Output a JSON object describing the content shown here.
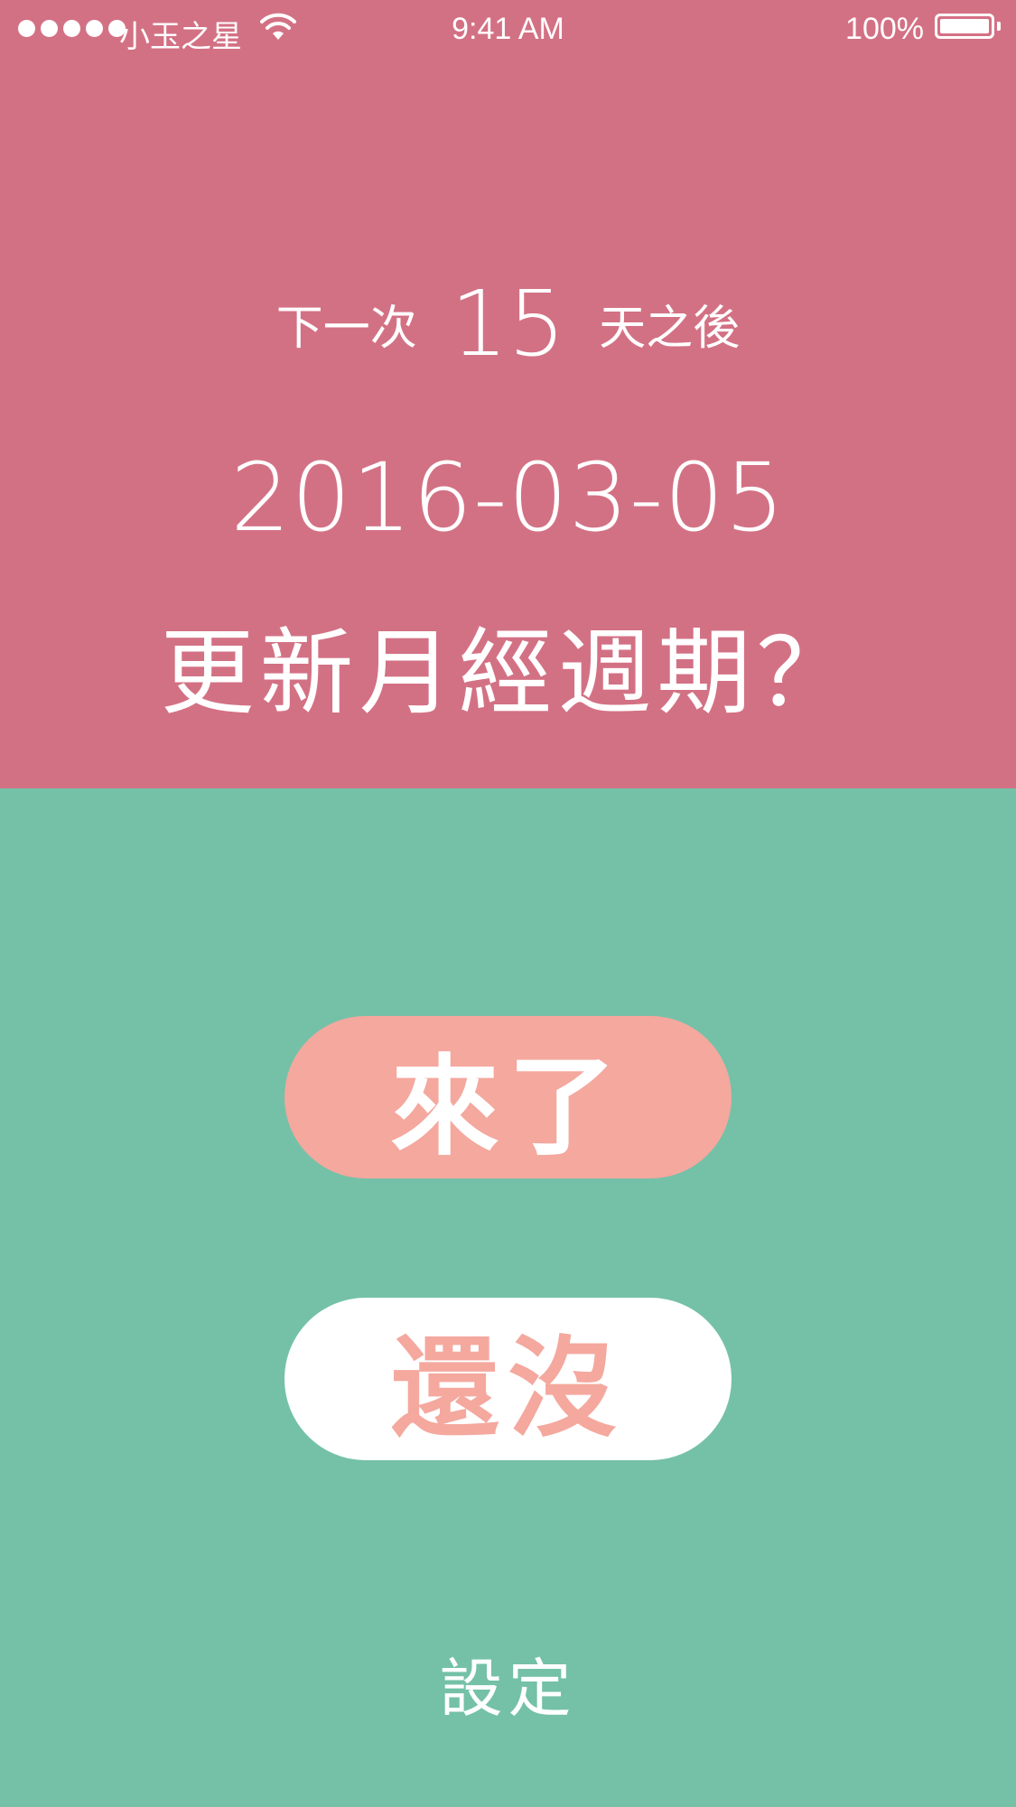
{
  "status_bar": {
    "carrier": "小玉之星",
    "time": "9:41 AM",
    "battery_percent": "100%",
    "battery_level": 1.0,
    "signal_bars": 5
  },
  "countdown": {
    "prefix": "下一次",
    "days": "15",
    "suffix": "天之後"
  },
  "next_date": "2016-03-05",
  "question": "更新月經週期？",
  "buttons": {
    "came": "來了",
    "not_yet": "還沒"
  },
  "settings_label": "設定",
  "colors": {
    "top_background": "#d37184",
    "bottom_background": "#74c1a8",
    "accent_pink": "#f4a89e",
    "white": "#ffffff"
  }
}
